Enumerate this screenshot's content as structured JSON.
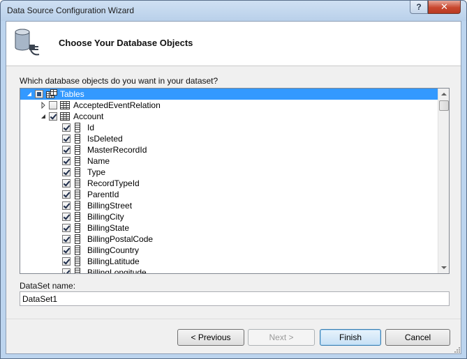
{
  "window": {
    "title": "Data Source Configuration Wizard",
    "help_glyph": "?",
    "close_glyph": "✕"
  },
  "header": {
    "title": "Choose Your Database Objects",
    "icon": "database-plug-icon"
  },
  "tree": {
    "prompt": "Which database objects do you want in your dataset?",
    "root": {
      "label": "Tables",
      "state": "partial",
      "expanded": true,
      "selected": true
    },
    "tables": [
      {
        "label": "AcceptedEventRelation",
        "state": "unchecked",
        "expanded": false
      },
      {
        "label": "Account",
        "state": "checked",
        "expanded": true
      }
    ],
    "columns": [
      "Id",
      "IsDeleted",
      "MasterRecordId",
      "Name",
      "Type",
      "RecordTypeId",
      "ParentId",
      "BillingStreet",
      "BillingCity",
      "BillingState",
      "BillingPostalCode",
      "BillingCountry",
      "BillingLatitude",
      "BillingLongitude"
    ]
  },
  "dataset": {
    "label": "DataSet name:",
    "value": "DataSet1"
  },
  "buttons": {
    "previous": "< Previous",
    "next": "Next >",
    "finish": "Finish",
    "cancel": "Cancel"
  },
  "colors": {
    "selection": "#3399ff",
    "close_button": "#c8472f",
    "title_bar": "#bcd4ee"
  }
}
